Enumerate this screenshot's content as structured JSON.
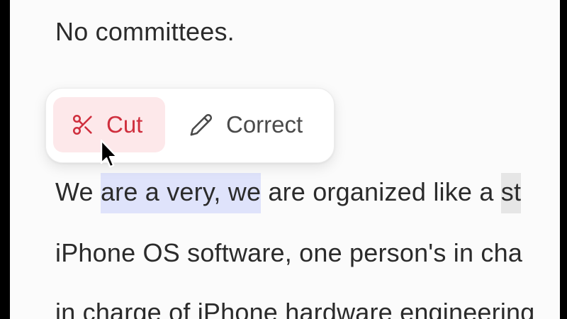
{
  "document": {
    "line_0": "No committees.",
    "line_1": {
      "before": "We ",
      "selected": "are a very, we",
      "after": " are organized like a ",
      "trailing_highlight": "st"
    },
    "line_2": "iPhone OS software, one person's in cha",
    "line_3": "in charge of iPhone hardware engineering"
  },
  "popup_menu": {
    "cut": {
      "label": "Cut",
      "icon": "scissors-icon"
    },
    "correct": {
      "label": "Correct",
      "icon": "pencil-icon"
    }
  },
  "colors": {
    "cut_accent": "#cf2f3e",
    "cut_background": "#fde8ea",
    "selection": "#dfe3fb",
    "text": "#2b2b2b"
  }
}
